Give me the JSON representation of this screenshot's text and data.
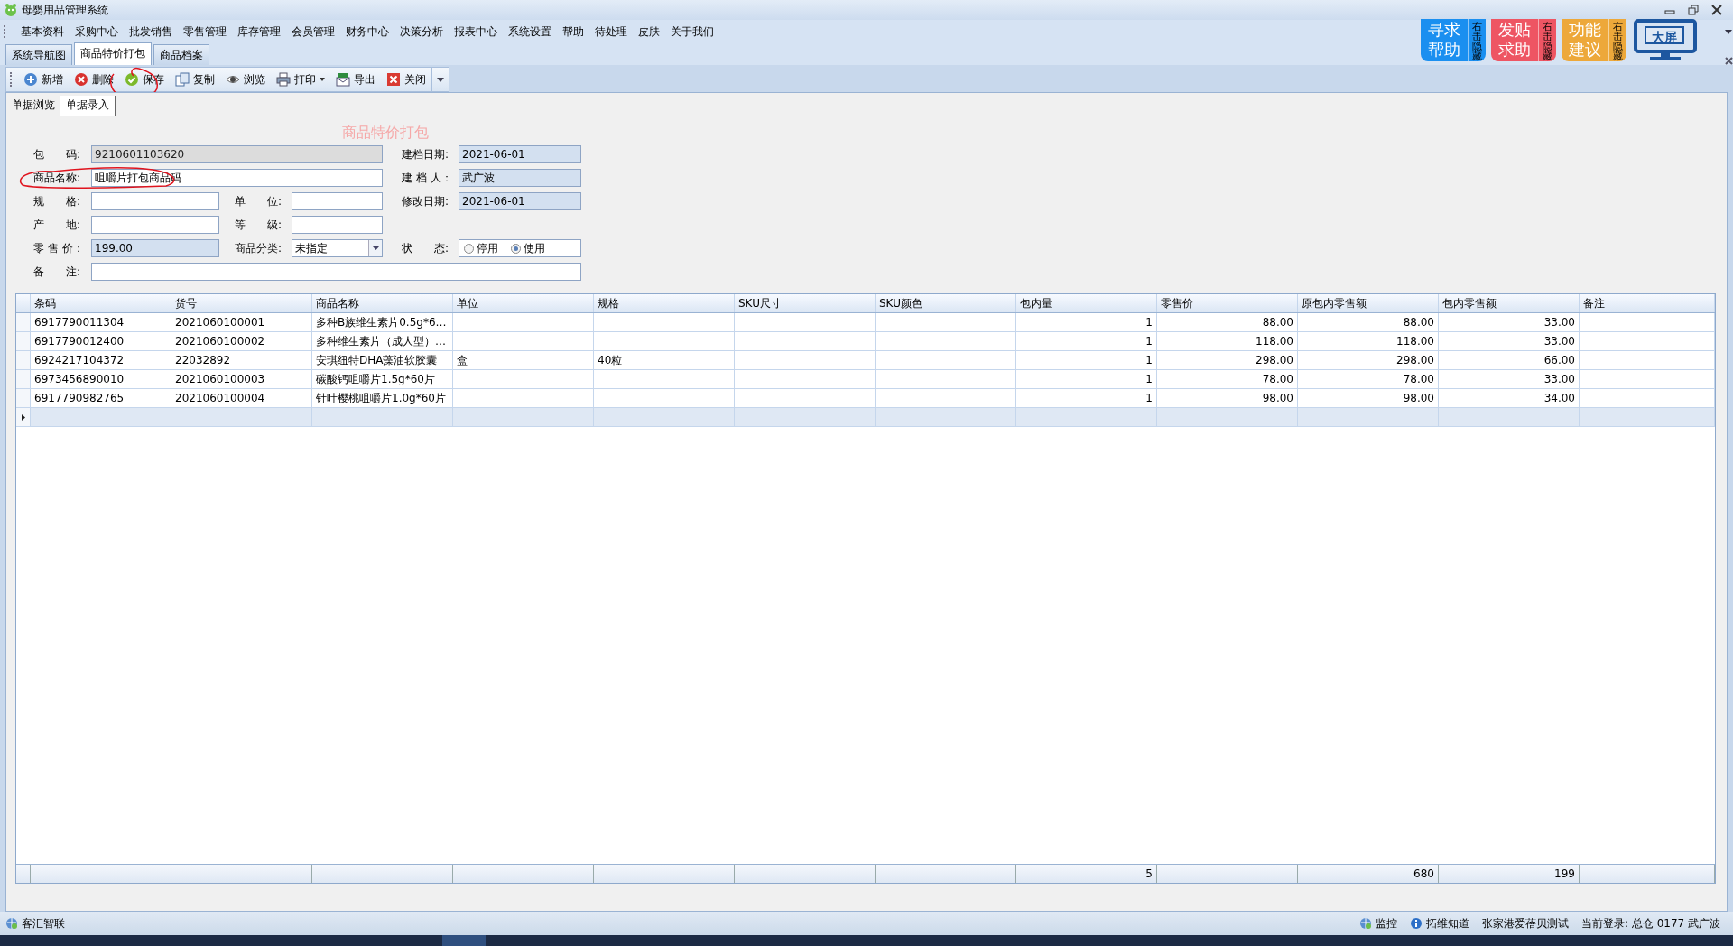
{
  "window": {
    "title": "母婴用品管理系统"
  },
  "menu": [
    "基本资料",
    "采购中心",
    "批发销售",
    "零售管理",
    "库存管理",
    "会员管理",
    "财务中心",
    "决策分析",
    "报表中心",
    "系统设置",
    "帮助",
    "待处理",
    "皮肤",
    "关于我们"
  ],
  "quick_tiles": [
    {
      "kind": "tile",
      "label": "寻求帮助",
      "side": "右击隐藏",
      "color": "#1a8ff0"
    },
    {
      "kind": "tile",
      "label": "发贴求助",
      "side": "右击隐藏",
      "color": "#ee5563"
    },
    {
      "kind": "tile",
      "label": "功能建议",
      "side": "右击隐藏",
      "color": "#eda83a"
    },
    {
      "kind": "monitor",
      "label": "大屏"
    }
  ],
  "tabs": [
    {
      "label": "系统导航图",
      "selected": false
    },
    {
      "label": "商品特价打包",
      "selected": true
    },
    {
      "label": "商品档案",
      "selected": false
    }
  ],
  "toolbar": [
    {
      "kind": "add",
      "label": "新增",
      "dropdown": false
    },
    {
      "kind": "delete",
      "label": "删除",
      "dropdown": false
    },
    {
      "kind": "save",
      "label": "保存",
      "dropdown": false
    },
    {
      "kind": "copy",
      "label": "复制",
      "dropdown": false
    },
    {
      "kind": "view",
      "label": "浏览",
      "dropdown": false
    },
    {
      "kind": "print",
      "label": "打印",
      "dropdown": true
    },
    {
      "kind": "export",
      "label": "导出",
      "dropdown": false
    },
    {
      "kind": "close",
      "label": "关闭",
      "dropdown": false
    }
  ],
  "subtabs": [
    {
      "label": "单据浏览",
      "selected": false
    },
    {
      "label": "单据录入",
      "selected": true
    }
  ],
  "form": {
    "title": "商品特价打包",
    "rows": [
      [
        {
          "kind": "disabled",
          "label": "包　　码:",
          "value": "9210601103620"
        },
        {
          "kind": "readonly",
          "label": "建档日期:",
          "value": "2021-06-01"
        }
      ],
      [
        {
          "kind": "text",
          "label": "商品名称:",
          "value": "咀嚼片打包商品码"
        },
        {
          "kind": "readonly",
          "label": "建 档 人：",
          "value": "武广波"
        }
      ],
      [
        {
          "kind": "text",
          "label": "规　　格:"
        },
        {
          "kind": "text",
          "label": "单　　位:"
        },
        {
          "kind": "readonly",
          "label": "修改日期:",
          "value": "2021-06-01"
        }
      ],
      [
        {
          "kind": "text",
          "label": "产　　地:"
        },
        {
          "kind": "text",
          "label": "等　　级:"
        },
        null
      ],
      [
        {
          "kind": "readonly",
          "label": "零 售 价：",
          "value": "199.00"
        },
        {
          "kind": "select",
          "label": "商品分类:",
          "value": "未指定"
        },
        {
          "kind": "radio",
          "label": "状　　态:",
          "options": [
            {
              "label": "停用",
              "selected": false
            },
            {
              "label": "使用",
              "selected": true
            }
          ]
        }
      ],
      [
        {
          "kind": "text",
          "label": "备　　注:"
        }
      ]
    ]
  },
  "table": {
    "columns": [
      {
        "label": "条码"
      },
      {
        "label": "货号"
      },
      {
        "label": "商品名称"
      },
      {
        "label": "单位"
      },
      {
        "label": "规格"
      },
      {
        "label": "SKU尺寸"
      },
      {
        "label": "SKU颜色"
      },
      {
        "label": "包内量",
        "numeric": true,
        "total": "5"
      },
      {
        "label": "零售价",
        "numeric": true
      },
      {
        "label": "原包内零售额",
        "numeric": true,
        "total": "680"
      },
      {
        "label": "包内零售额",
        "numeric": true,
        "total": "199"
      },
      {
        "label": "备注"
      }
    ],
    "rows": [
      [
        "6917790011304",
        "2021060100001",
        "多种B族维生素片0.5g*6…",
        null,
        null,
        null,
        null,
        "1",
        "88.00",
        "88.00",
        "33.00",
        null
      ],
      [
        "6917790012400",
        "2021060100002",
        "多种维生素片（成人型）…",
        null,
        null,
        null,
        null,
        "1",
        "118.00",
        "118.00",
        "33.00",
        null
      ],
      [
        "6924217104372",
        "22032892",
        "安琪纽特DHA藻油软胶囊",
        "盒",
        "40粒",
        null,
        null,
        "1",
        "298.00",
        "298.00",
        "66.00",
        null
      ],
      [
        "6973456890010",
        "2021060100003",
        "碳酸钙咀嚼片1.5g*60片",
        null,
        null,
        null,
        null,
        "1",
        "78.00",
        "78.00",
        "33.00",
        null
      ],
      [
        "6917790982765",
        "2021060100004",
        "针叶樱桃咀嚼片1.0g*60片",
        null,
        null,
        null,
        null,
        "1",
        "98.00",
        "98.00",
        "34.00",
        null
      ]
    ],
    "new_row": true
  },
  "status_bar": {
    "left": [
      {
        "kind": "globe",
        "text": "客汇智联"
      }
    ],
    "right": [
      {
        "kind": "globe",
        "text": "监控"
      },
      {
        "kind": "info",
        "text": "拓维知道"
      },
      {
        "kind": "plain",
        "text": "张家港爱蓓贝测试"
      },
      {
        "kind": "plain",
        "text": "当前登录: 总仓 0177 武广波"
      }
    ]
  }
}
